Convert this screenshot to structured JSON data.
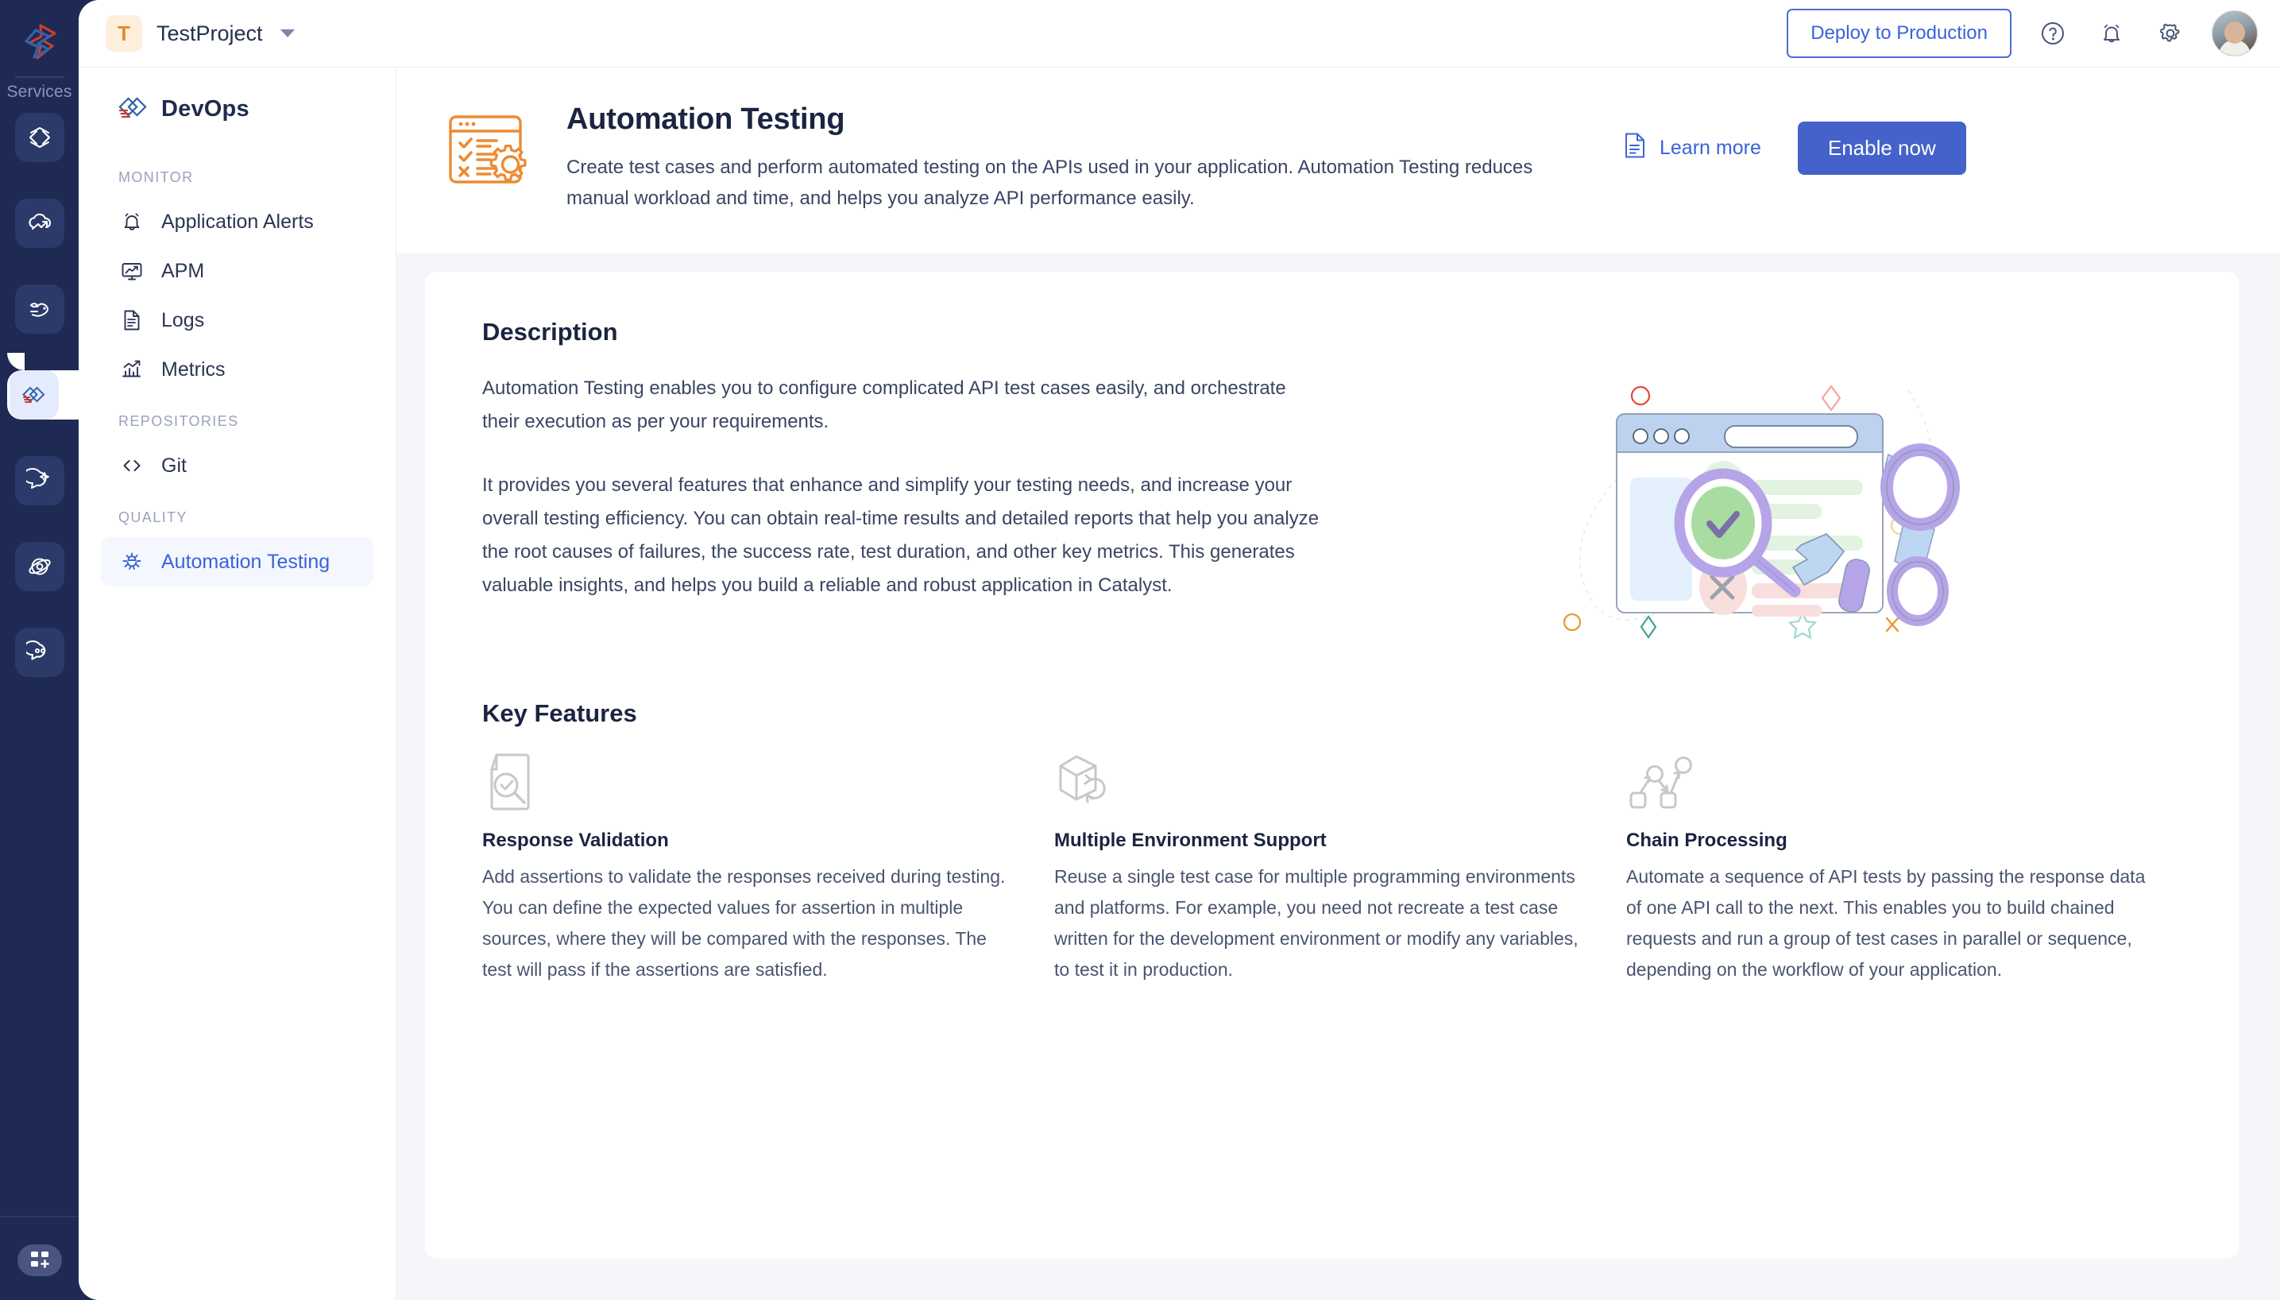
{
  "rail": {
    "logo_icon": "catalyst-logo-icon",
    "services_label": "Services",
    "items": [
      {
        "icon": "code-brackets-icon",
        "name": "code"
      },
      {
        "icon": "cloud-scale-icon",
        "name": "cloud"
      },
      {
        "icon": "functions-icon",
        "name": "functions"
      },
      {
        "icon": "devops-icon",
        "name": "devops",
        "active": true
      },
      {
        "icon": "ai-chat-icon",
        "name": "ai"
      },
      {
        "icon": "orbit-icon",
        "name": "orbit"
      },
      {
        "icon": "chat-bubble-icon",
        "name": "chat"
      }
    ],
    "bottom_icon": "app-grid-add-icon"
  },
  "topbar": {
    "project_initial": "T",
    "project_name": "TestProject",
    "caret_icon": "chevron-down-icon",
    "deploy_label": "Deploy to Production",
    "help_icon": "question-circle-icon",
    "bell_icon": "bell-icon",
    "gear_icon": "gear-icon",
    "avatar": "user-avatar"
  },
  "leftnav": {
    "title": "DevOps",
    "logo_icon": "devops-diamond-icon",
    "groups": [
      {
        "label": "MONITOR",
        "items": [
          {
            "label": "Application Alerts",
            "icon": "bell-alert-icon",
            "active": false
          },
          {
            "label": "APM",
            "icon": "monitor-chart-icon",
            "active": false
          },
          {
            "label": "Logs",
            "icon": "document-lines-icon",
            "active": false
          },
          {
            "label": "Metrics",
            "icon": "bar-chart-arrow-icon",
            "active": false
          }
        ]
      },
      {
        "label": "REPOSITORIES",
        "items": [
          {
            "label": "Git",
            "icon": "code-angle-brackets-icon",
            "active": false
          }
        ]
      },
      {
        "label": "QUALITY",
        "items": [
          {
            "label": "Automation Testing",
            "icon": "bug-icon",
            "active": true
          }
        ]
      }
    ]
  },
  "hero": {
    "icon": "automation-testing-icon",
    "title": "Automation Testing",
    "description": "Create test cases and perform automated testing on the APIs used in your application. Automation Testing reduces manual workload and time, and helps you analyze API performance easily.",
    "learn_more_label": "Learn more",
    "learn_more_icon": "document-icon",
    "enable_label": "Enable now"
  },
  "main": {
    "description_heading": "Description",
    "description_paragraphs": [
      "Automation Testing enables you to configure complicated API test cases easily, and orchestrate their execution as per your requirements.",
      "It provides you several features that enhance and simplify your testing needs, and increase your overall testing efficiency. You can obtain real-time results and detailed reports that help you analyze the root causes of failures, the success rate, test duration, and other key metrics. This generates valuable insights, and helps you build a reliable and robust application in Catalyst."
    ],
    "illustration": "automation-testing-illustration",
    "key_features_heading": "Key Features",
    "features": [
      {
        "icon": "document-search-check-icon",
        "name": "Response Validation",
        "text": "Add assertions to validate the responses received during testing. You can define the expected values for assertion in multiple sources, where they will be compared with the responses. The test will pass if the assertions are satisfied."
      },
      {
        "icon": "cube-refresh-icon",
        "name": "Multiple Environment Support",
        "text": "Reuse a single test case for multiple programming environments and platforms. For example, you need not recreate a test case written for the development environment or modify any variables, to test it in production."
      },
      {
        "icon": "node-chain-icon",
        "name": "Chain Processing",
        "text": "Automate a sequence of API tests by passing the response data of one API call to the next. This enables you to build chained requests and run a group of test cases in parallel or sequence, depending on the workflow of your application."
      }
    ]
  },
  "colors": {
    "rail_bg": "#1e2a54",
    "accent_blue": "#3a63d8",
    "enable_btn": "#4462c9",
    "hero_icon_orange": "#ec8b32",
    "page_bg": "#f5f6fa",
    "active_nav_bg": "#f4f7fe"
  }
}
